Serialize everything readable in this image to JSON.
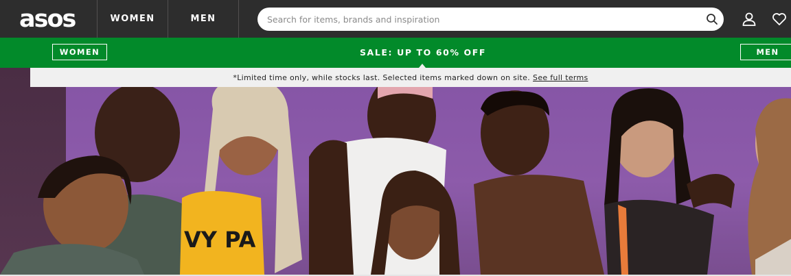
{
  "header": {
    "logo_text": "asos",
    "nav": [
      {
        "label": "WOMEN"
      },
      {
        "label": "MEN"
      }
    ],
    "search": {
      "placeholder": "Search for items, brands and inspiration",
      "value": ""
    }
  },
  "sale_bar": {
    "left_button": "WOMEN",
    "title": "SALE: UP TO 60% OFF",
    "right_button": "MEN",
    "color": "#028a2a"
  },
  "terms_bar": {
    "text": "*Limited time only, while stocks last. Selected items marked down on site.",
    "link": "See full terms"
  },
  "hero": {
    "shirt_text": "VY PA"
  },
  "colors": {
    "topbar": "#2d2d2d",
    "sale_green": "#028a2a",
    "terms_bg": "#f0f0f0",
    "hero_purple": "#8a58a8"
  },
  "icons": [
    "search-icon",
    "account-icon",
    "heart-icon"
  ]
}
